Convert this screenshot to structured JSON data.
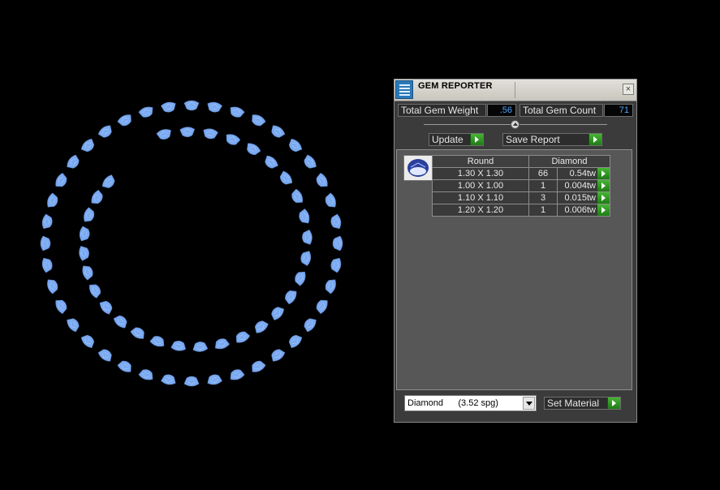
{
  "panel": {
    "title": "GEM REPORTER",
    "close_glyph": "×",
    "total_weight_label": "Total Gem Weight",
    "total_weight_value": ".56",
    "total_count_label": "Total Gem Count",
    "total_count_value": "71",
    "update_label": "Update",
    "save_report_label": "Save Report",
    "set_material_label": "Set Material",
    "material_selected": "Diamond      (3.52 spg)"
  },
  "table": {
    "shape_header": "Round",
    "material_header": "Diamond",
    "rows": [
      {
        "size": "1.30 X 1.30",
        "count": "66",
        "weight": "0.54tw"
      },
      {
        "size": "1.00 X 1.00",
        "count": "1",
        "weight": "0.004tw"
      },
      {
        "size": "1.10 X 1.10",
        "count": "3",
        "weight": "0.015tw"
      },
      {
        "size": "1.20 X 1.20",
        "count": "1",
        "weight": "0.006tw"
      }
    ]
  },
  "icons": [
    "gem-reporter-icon",
    "close-icon",
    "slider-up-icon",
    "go-arrow-icon",
    "round-gem-icon",
    "dropdown-arrow-icon"
  ],
  "colors": {
    "viewport_bg": "#000000",
    "gem_fill": "#7aaaf0",
    "panel_bg": "#3b3b3b",
    "value_text": "#4fa3ff",
    "go_button": "#2f9a22"
  }
}
